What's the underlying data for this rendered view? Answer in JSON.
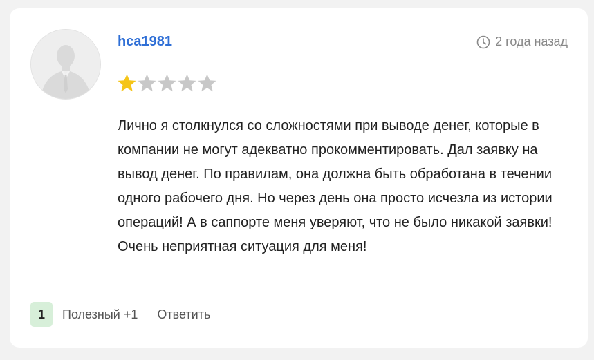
{
  "review": {
    "author": "hca1981",
    "time_ago": "2 года назад",
    "rating": 1,
    "rating_max": 5,
    "text": "Лично я столкнулся со сложностями при выводе денег, которые в компании не могут адекватно прокомментировать. Дал заявку на вывод денег. По правилам, она должна быть обработана в течении одного рабочего дня. Но через день она просто исчезла из истории операций! А в саппорте меня уверяют, что не было никакой заявки! Очень неприятная ситуация для меня!",
    "likes_count": "1",
    "helpful_label": "Полезный +1",
    "reply_label": "Ответить"
  },
  "icons": {
    "avatar": "default-user-silhouette",
    "time": "clock-icon",
    "star": "star-icon"
  },
  "colors": {
    "username": "#2f6fd6",
    "star_filled": "#f5c518",
    "star_empty": "#c8c8c8",
    "likes_badge_bg": "#d7efd9",
    "muted_text": "#888888"
  }
}
